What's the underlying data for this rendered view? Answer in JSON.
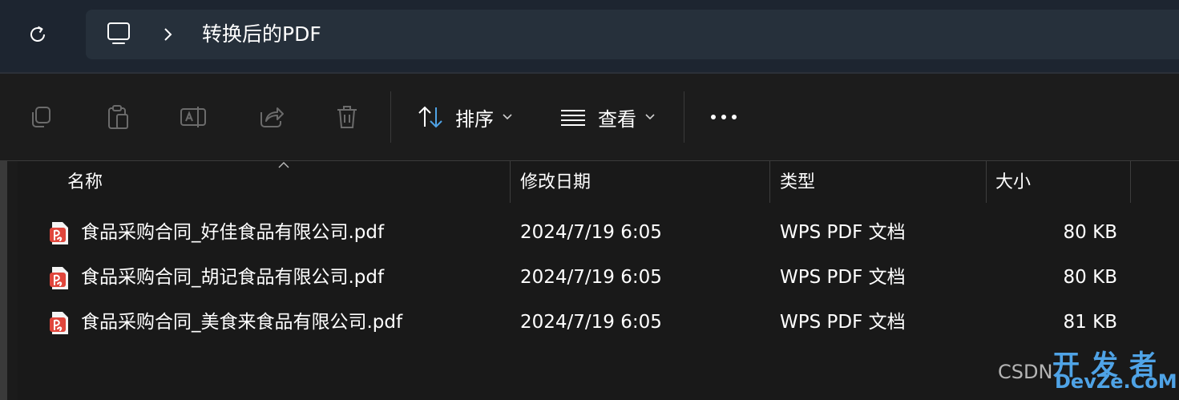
{
  "address_bar": {
    "refresh_icon": "refresh-icon",
    "location_icon": "this-pc-icon",
    "separator_icon": "chevron-right-icon",
    "path": "转换后的PDF"
  },
  "toolbar": {
    "icons": [
      "copy-icon",
      "paste-icon",
      "rename-icon",
      "share-icon",
      "delete-icon"
    ],
    "sort_label": "排序",
    "view_label": "查看",
    "more_icon": "more-icon"
  },
  "columns": {
    "name": "名称",
    "modified": "修改日期",
    "type": "类型",
    "size": "大小"
  },
  "files": [
    {
      "name": "食品采购合同_好佳食品有限公司.pdf",
      "modified": "2024/7/19 6:05",
      "type": "WPS PDF 文档",
      "size": "80 KB"
    },
    {
      "name": "食品采购合同_胡记食品有限公司.pdf",
      "modified": "2024/7/19 6:05",
      "type": "WPS PDF 文档",
      "size": "80 KB"
    },
    {
      "name": "食品采购合同_美食来食品有限公司.pdf",
      "modified": "2024/7/19 6:05",
      "type": "WPS PDF 文档",
      "size": "81 KB"
    }
  ],
  "watermark": {
    "csdn": "CSDN",
    "title": "开发者",
    "domain": "DevZe.CoM"
  },
  "colors": {
    "background": "#191919",
    "address_bar": "#1d2530",
    "pdf_icon": "#e0463c",
    "sort_accent": "#4fa3e6"
  }
}
